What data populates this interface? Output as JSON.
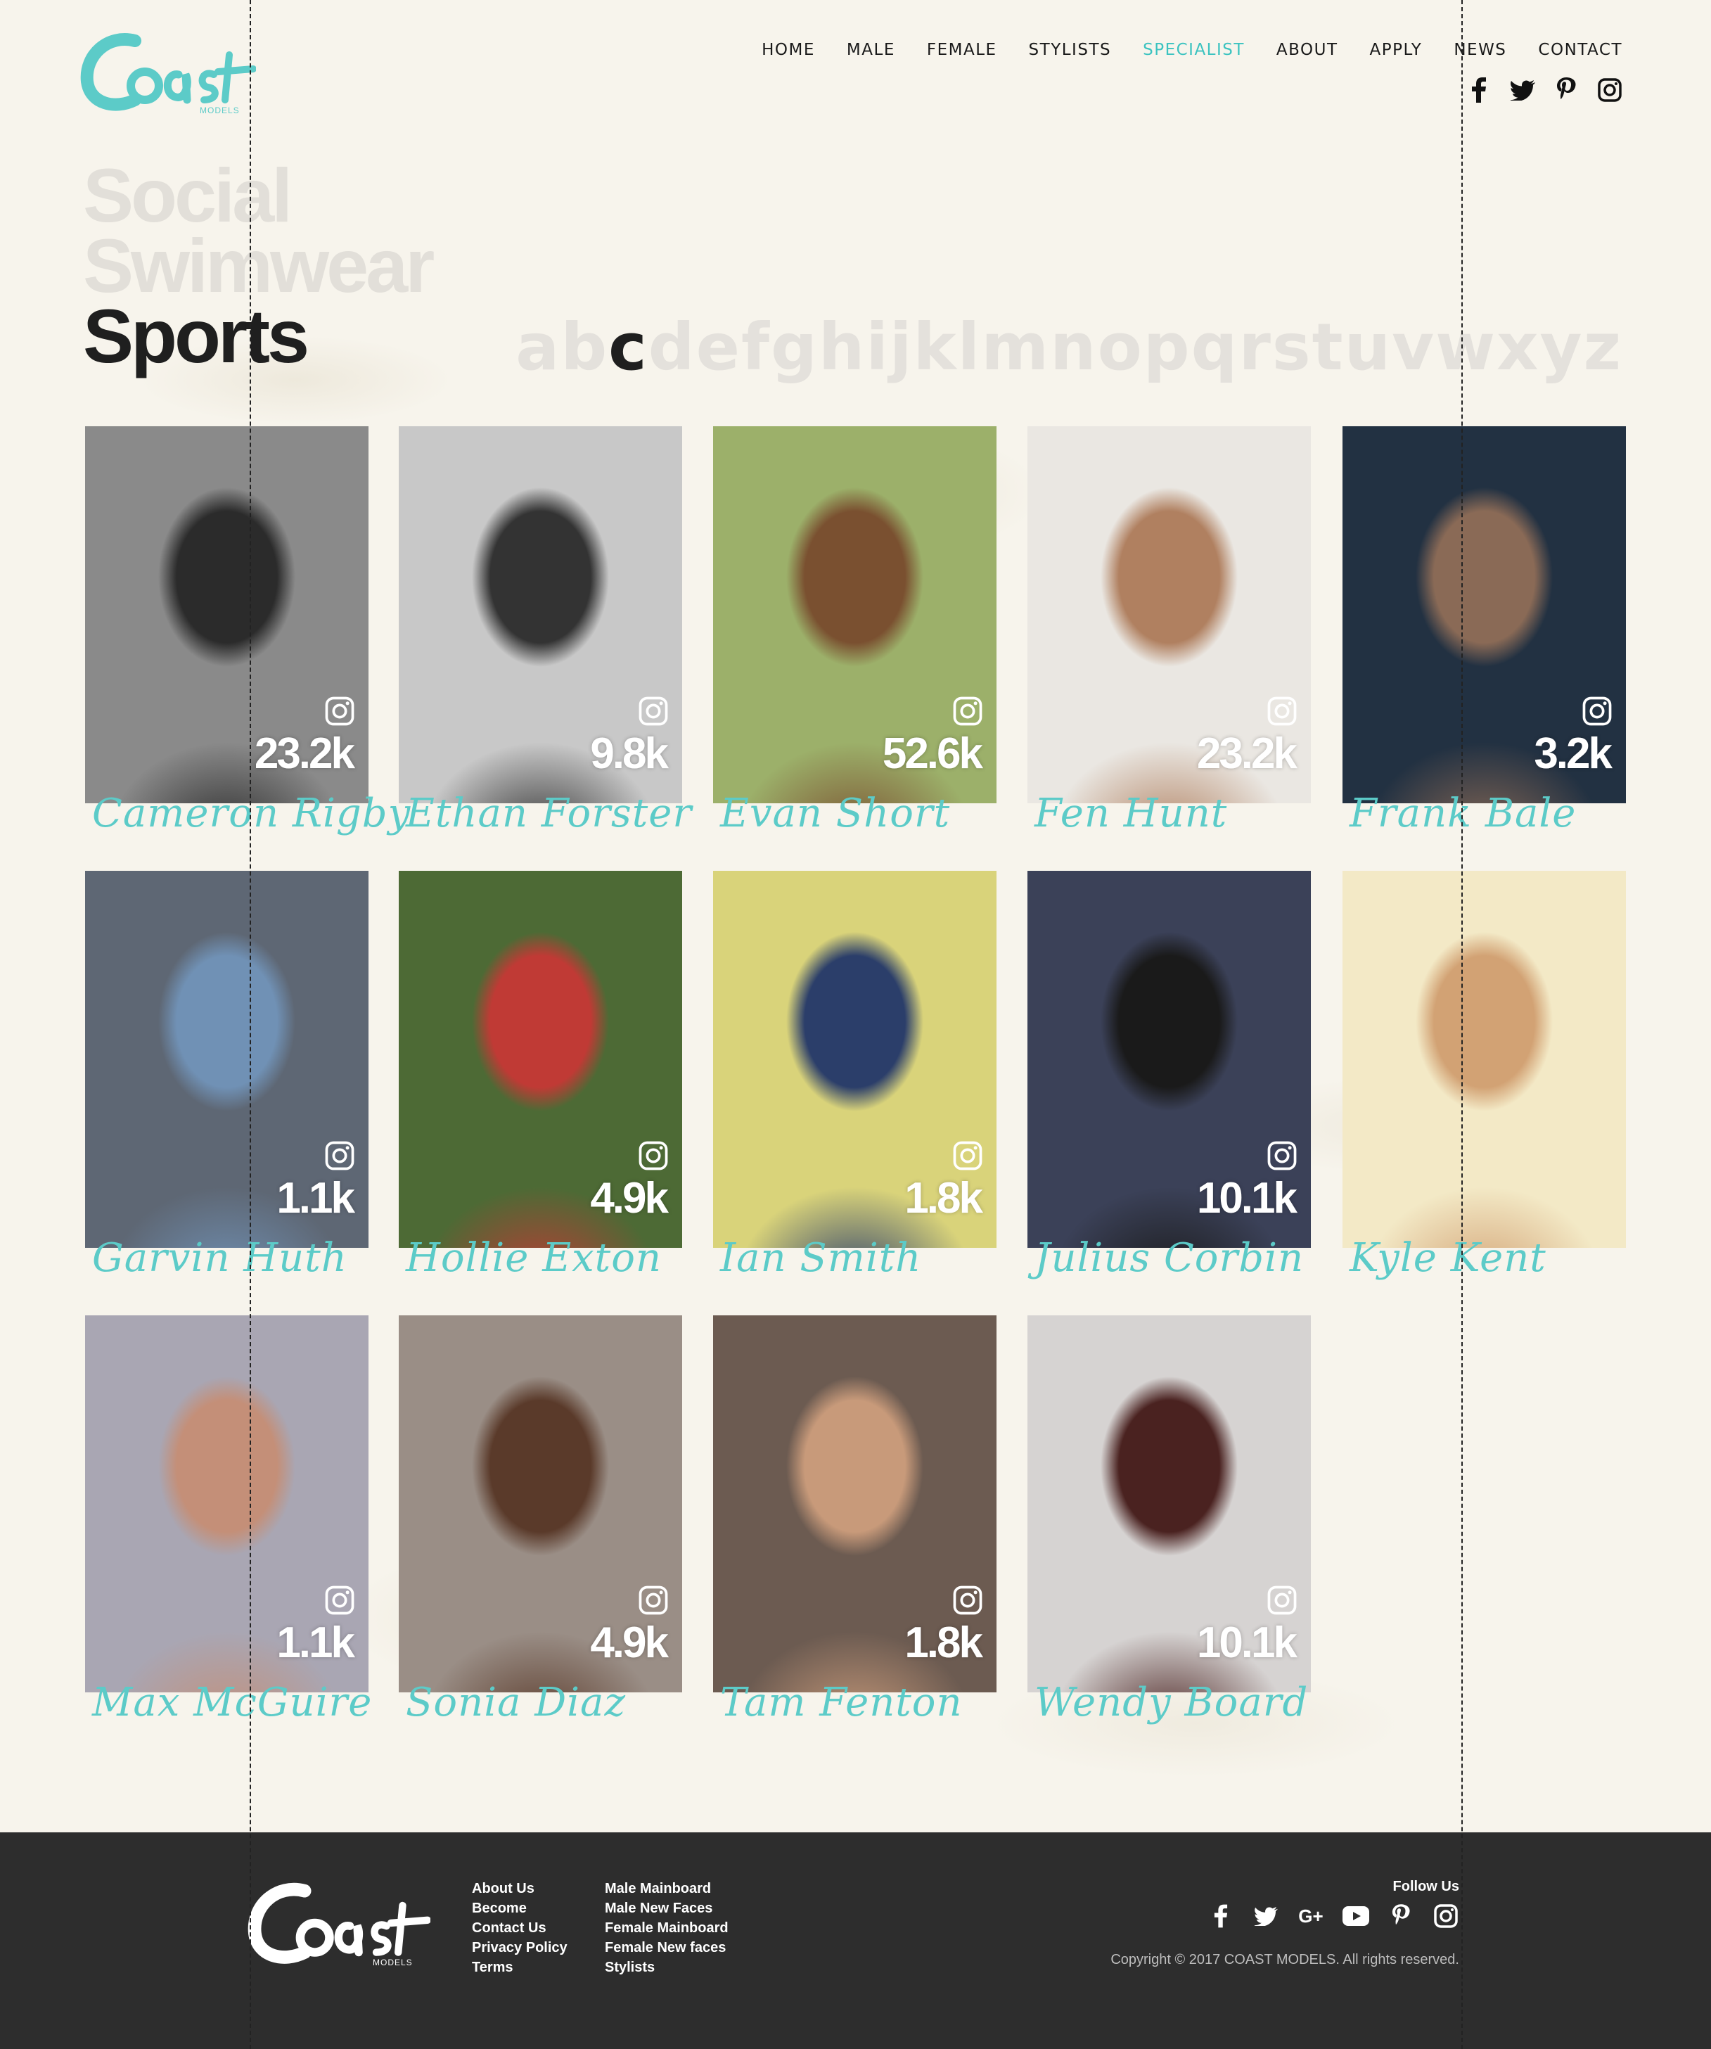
{
  "brand": {
    "name": "Coast",
    "sub": "MODELS",
    "accent": "#3cc3c0"
  },
  "nav": [
    {
      "label": "HOME",
      "active": false
    },
    {
      "label": "MALE",
      "active": false
    },
    {
      "label": "FEMALE",
      "active": false
    },
    {
      "label": "STYLISTS",
      "active": false
    },
    {
      "label": "SPECIALIST",
      "active": true
    },
    {
      "label": "ABOUT",
      "active": false
    },
    {
      "label": "APPLY",
      "active": false
    },
    {
      "label": "NEWS",
      "active": false
    },
    {
      "label": "CONTACT",
      "active": false
    }
  ],
  "social_top": [
    "facebook-icon",
    "twitter-icon",
    "pinterest-icon",
    "instagram-icon"
  ],
  "categories": [
    {
      "label": "Social",
      "active": false
    },
    {
      "label": "Swimwear",
      "active": false
    },
    {
      "label": "Sports",
      "active": true
    }
  ],
  "alphabet": {
    "letters": [
      "a",
      "b",
      "c",
      "d",
      "e",
      "f",
      "g",
      "h",
      "i",
      "j",
      "k",
      "l",
      "m",
      "n",
      "o",
      "p",
      "q",
      "r",
      "s",
      "t",
      "u",
      "v",
      "w",
      "x",
      "y",
      "z"
    ],
    "active": "c"
  },
  "models": [
    {
      "name": "Cameron Rigby",
      "followers": "23.2k",
      "palette": [
        "#8a8a8a",
        "#2b2b2b"
      ]
    },
    {
      "name": "Ethan Forster",
      "followers": "9.8k",
      "palette": [
        "#c8c8c8",
        "#333333"
      ]
    },
    {
      "name": "Evan Short",
      "followers": "52.6k",
      "palette": [
        "#9cb06a",
        "#7a5030"
      ]
    },
    {
      "name": "Fen Hunt",
      "followers": "23.2k",
      "palette": [
        "#eae7e2",
        "#b08060"
      ]
    },
    {
      "name": "Frank Bale",
      "followers": "3.2k",
      "palette": [
        "#223142",
        "#8a6a56"
      ]
    },
    {
      "name": "Garvin Huth",
      "followers": "1.1k",
      "palette": [
        "#5e6774",
        "#7091b5"
      ]
    },
    {
      "name": "Hollie Exton",
      "followers": "4.9k",
      "palette": [
        "#4d6a35",
        "#c03a35"
      ]
    },
    {
      "name": "Ian Smith",
      "followers": "1.8k",
      "palette": [
        "#d9d37a",
        "#2b3e6a"
      ]
    },
    {
      "name": "Julius Corbin",
      "followers": "10.1k",
      "palette": [
        "#3b4158",
        "#1a1a1a"
      ]
    },
    {
      "name": "Kyle Kent",
      "followers": "",
      "palette": [
        "#f3e9c6",
        "#d2a274"
      ]
    },
    {
      "name": "Max McGuire",
      "followers": "1.1k",
      "palette": [
        "#a9a6b3",
        "#c48f78"
      ]
    },
    {
      "name": "Sonia Diaz",
      "followers": "4.9k",
      "palette": [
        "#9a8e86",
        "#5a3a2a"
      ]
    },
    {
      "name": "Tam Fenton",
      "followers": "1.8k",
      "palette": [
        "#6c5b51",
        "#c89a7a"
      ]
    },
    {
      "name": "Wendy Board",
      "followers": "10.1k",
      "palette": [
        "#d6d3d2",
        "#4a2220"
      ]
    }
  ],
  "footer": {
    "col1": [
      "About Us",
      "Become",
      "Contact Us",
      "Privacy Policy",
      "Terms"
    ],
    "col2": [
      "Male Mainboard",
      "Male New Faces",
      "Female Mainboard",
      "Female New faces",
      "Stylists"
    ],
    "follow_label": "Follow Us",
    "social": [
      "facebook-icon",
      "twitter-icon",
      "google-plus-icon",
      "youtube-icon",
      "pinterest-icon",
      "instagram-icon"
    ],
    "google_plus_text": "G+",
    "copyright": "Copyright © 2017 COAST MODELS. All rights reserved."
  }
}
